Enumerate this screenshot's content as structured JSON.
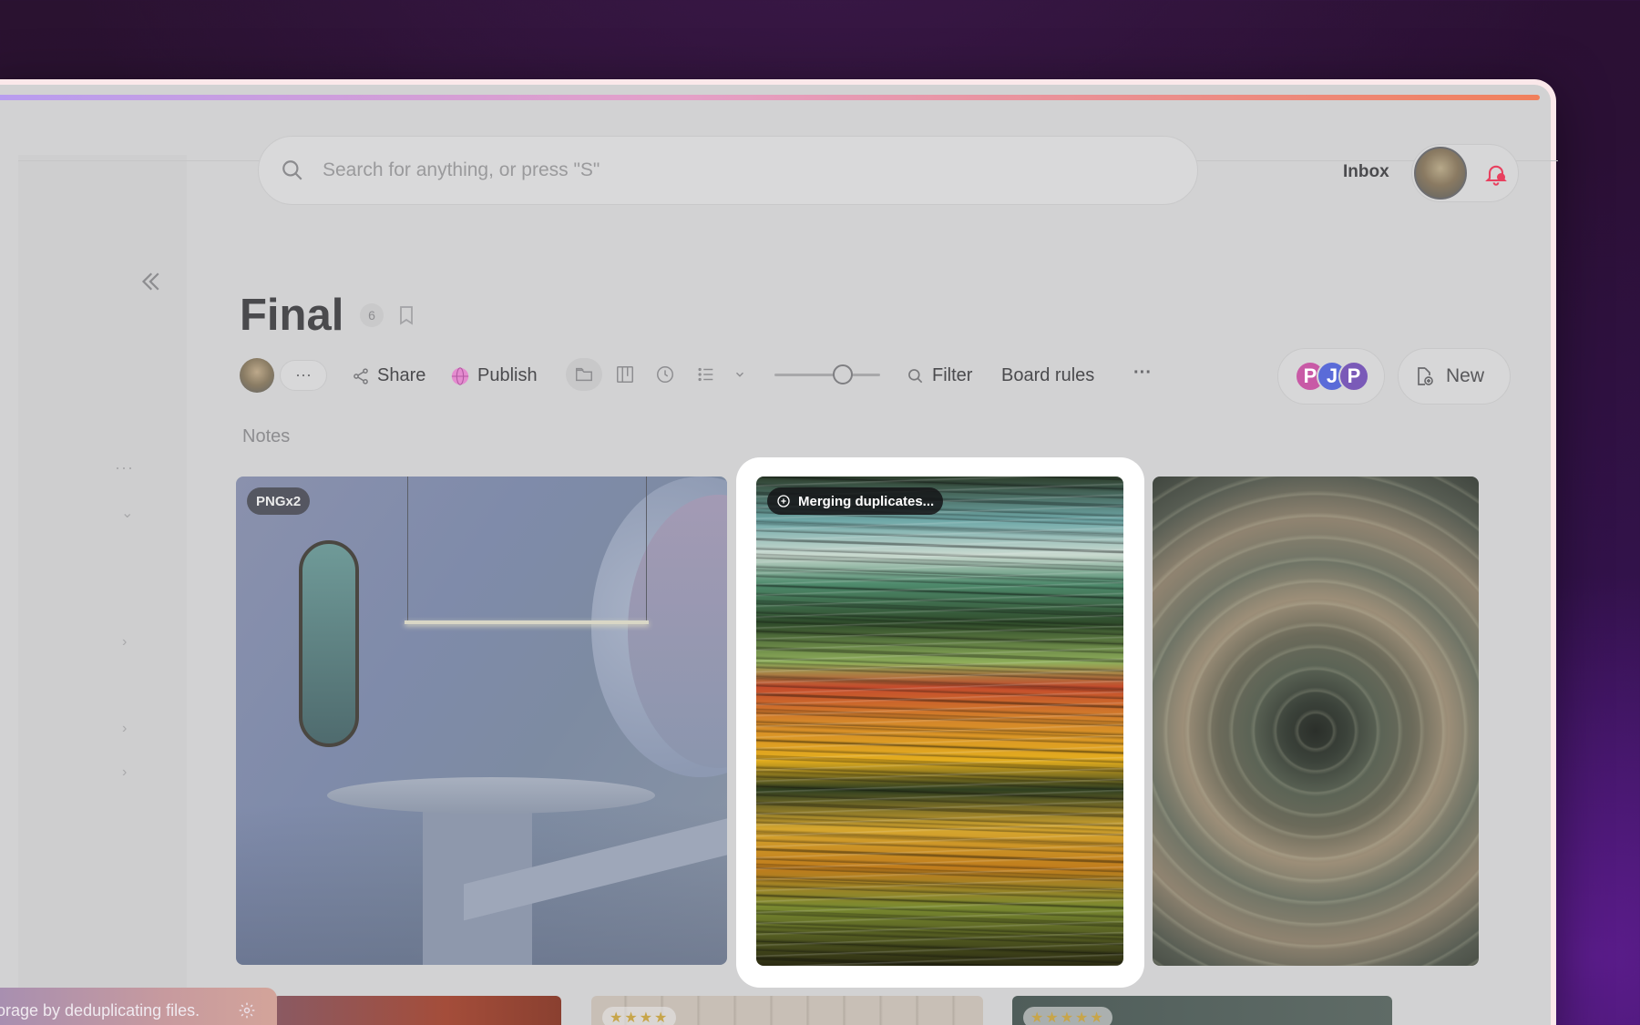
{
  "search": {
    "placeholder": "Search for anything, or press \"S\""
  },
  "header": {
    "inbox_label": "Inbox"
  },
  "board": {
    "title": "Final",
    "item_count": "6"
  },
  "toolbar": {
    "more_label": "···",
    "share_label": "Share",
    "publish_label": "Publish",
    "filter_label": "Filter",
    "board_rules_label": "Board rules",
    "overflow_label": "···",
    "zoom_level": 0.65,
    "new_label": "New"
  },
  "collaborators": [
    "P",
    "J",
    "P"
  ],
  "sidebar": {
    "dots": "···"
  },
  "section": {
    "label": "Notes"
  },
  "cards": [
    {
      "badge": "PNGx2",
      "image": "interior-scene"
    },
    {
      "badge": "Merging duplicates...",
      "image": "motion-blur-lights",
      "highlighted": true
    },
    {
      "badge": "",
      "image": "radial-blur-tunnel"
    }
  ],
  "bottom_cards": [
    {
      "stars": ""
    },
    {
      "stars": "★★★★"
    },
    {
      "stars": "★★★★★"
    }
  ],
  "toast": {
    "text": "orage by deduplicating files."
  },
  "colors": {
    "accent_bell": "#e8405f",
    "highlight_frame": "#ffffff",
    "publish_icon": "#e48ccf"
  }
}
